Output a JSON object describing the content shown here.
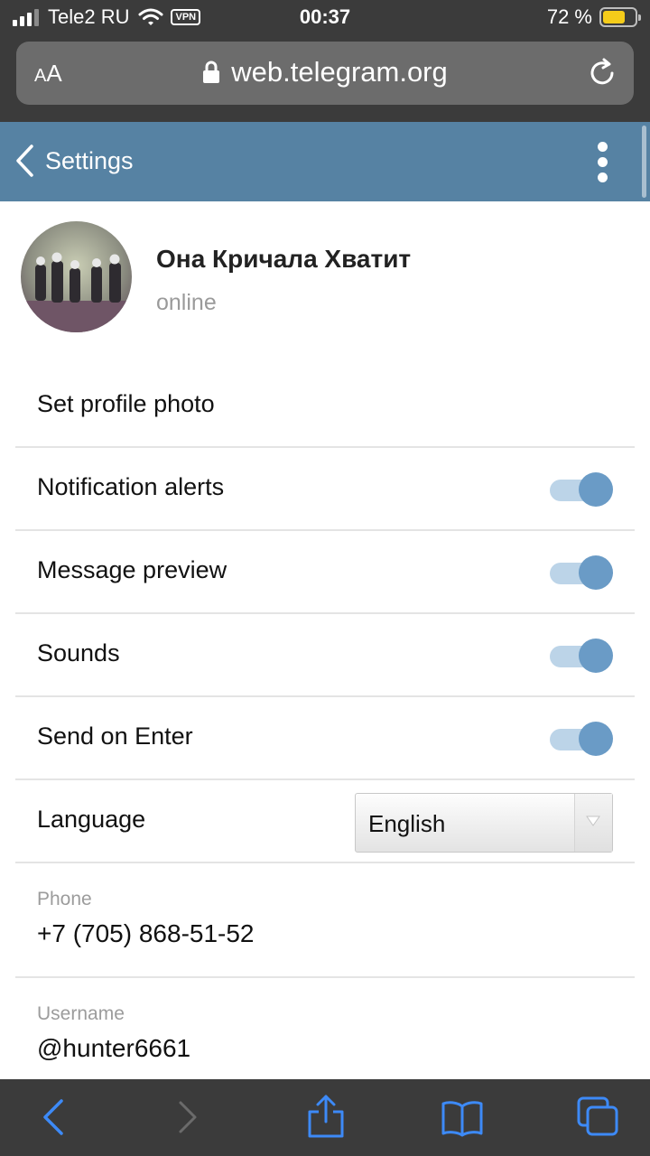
{
  "status_bar": {
    "carrier": "Tele2 RU",
    "vpn": "VPN",
    "time": "00:37",
    "battery_percent": "72 %",
    "battery_level": 0.72
  },
  "browser": {
    "text_size_label": "AA",
    "url": "web.telegram.org"
  },
  "header": {
    "back_label": "Settings"
  },
  "profile": {
    "name": "Она Кричала Хватит",
    "status": "online"
  },
  "settings": {
    "set_photo": "Set profile photo",
    "notification_alerts": {
      "label": "Notification alerts",
      "on": true
    },
    "message_preview": {
      "label": "Message preview",
      "on": true
    },
    "sounds": {
      "label": "Sounds",
      "on": true
    },
    "send_on_enter": {
      "label": "Send on Enter",
      "on": true
    },
    "language": {
      "label": "Language",
      "value": "English"
    }
  },
  "info": {
    "phone_label": "Phone",
    "phone_value": "+7 (705) 868-51-52",
    "username_label": "Username",
    "username_value": "@hunter6661"
  },
  "colors": {
    "header": "#5682a3",
    "toggle_knob": "#6a9bc6",
    "toggle_track": "#bcd4e8",
    "safari_accent": "#3d8af7"
  }
}
